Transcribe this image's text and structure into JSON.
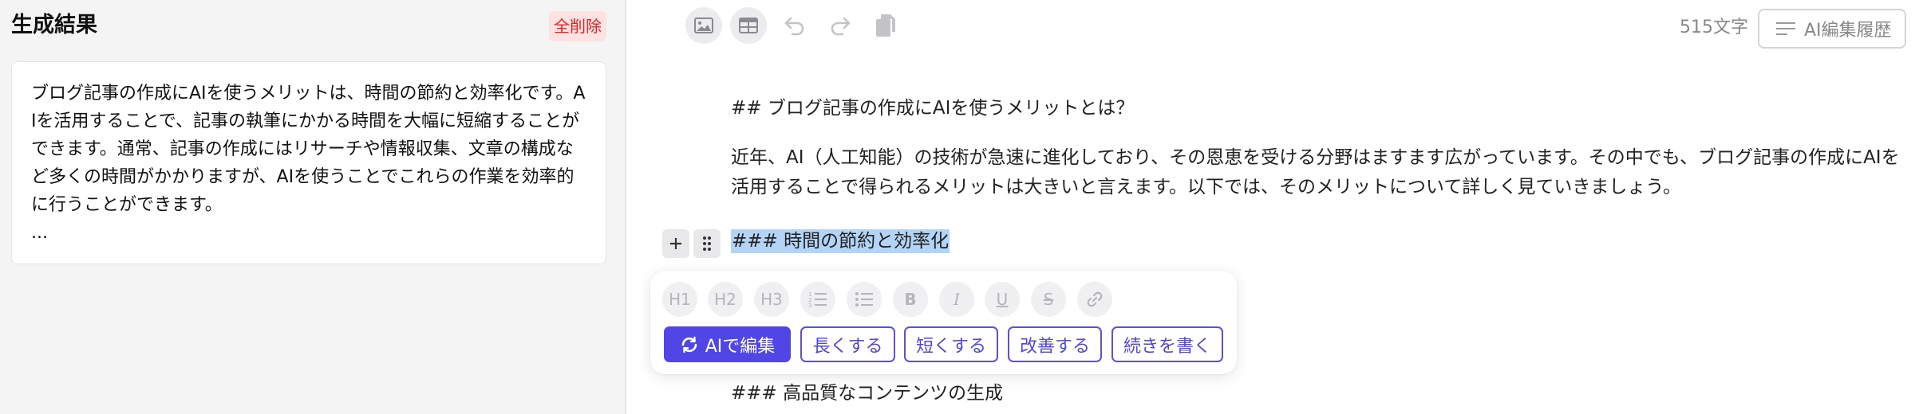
{
  "left_panel": {
    "title": "生成結果",
    "clear_button": "全削除",
    "result_text": "ブログ記事の作成にAIを使うメリットは、時間の節約と効率化です。AIを活用することで、記事の執筆にかかる時間を大幅に短縮することができます。通常、記事の作成にはリサーチや情報収集、文章の構成など多くの時間がかかりますが、AIを使うことでこれらの作業を効率的に行うことができます。\n..."
  },
  "toolbar": {
    "icons": [
      "image-icon",
      "table-icon",
      "undo-icon",
      "redo-icon",
      "copy-icon"
    ],
    "char_count": "515文字",
    "history_button": "AI編集履歴"
  },
  "editor": {
    "heading2": "## ブログ記事の作成にAIを使うメリットとは？",
    "paragraph": "近年、AI（人工知能）の技術が急速に進化しており、その恩恵を受ける分野はますます広がっています。その中でも、ブログ記事の作成にAIを活用することで得られるメリットは大きいと言えます。以下では、そのメリットについて詳しく見ていきましょう。",
    "selected_heading": "### 時間の節約と効率化",
    "next_heading": "### 高品質なコンテンツの生成"
  },
  "bubble_menu": {
    "format_buttons": [
      "H1",
      "H2",
      "H3",
      "ordered-list-icon",
      "bullet-list-icon",
      "B",
      "I",
      "U",
      "S",
      "link-icon"
    ],
    "ai_button": "AIで編集",
    "actions": [
      "長くする",
      "短くする",
      "改善する",
      "続きを書く"
    ]
  },
  "colors": {
    "accent": "#4f46e5",
    "danger": "#e02424",
    "danger_bg": "#fde2e2",
    "selection": "#b3d4f5"
  }
}
